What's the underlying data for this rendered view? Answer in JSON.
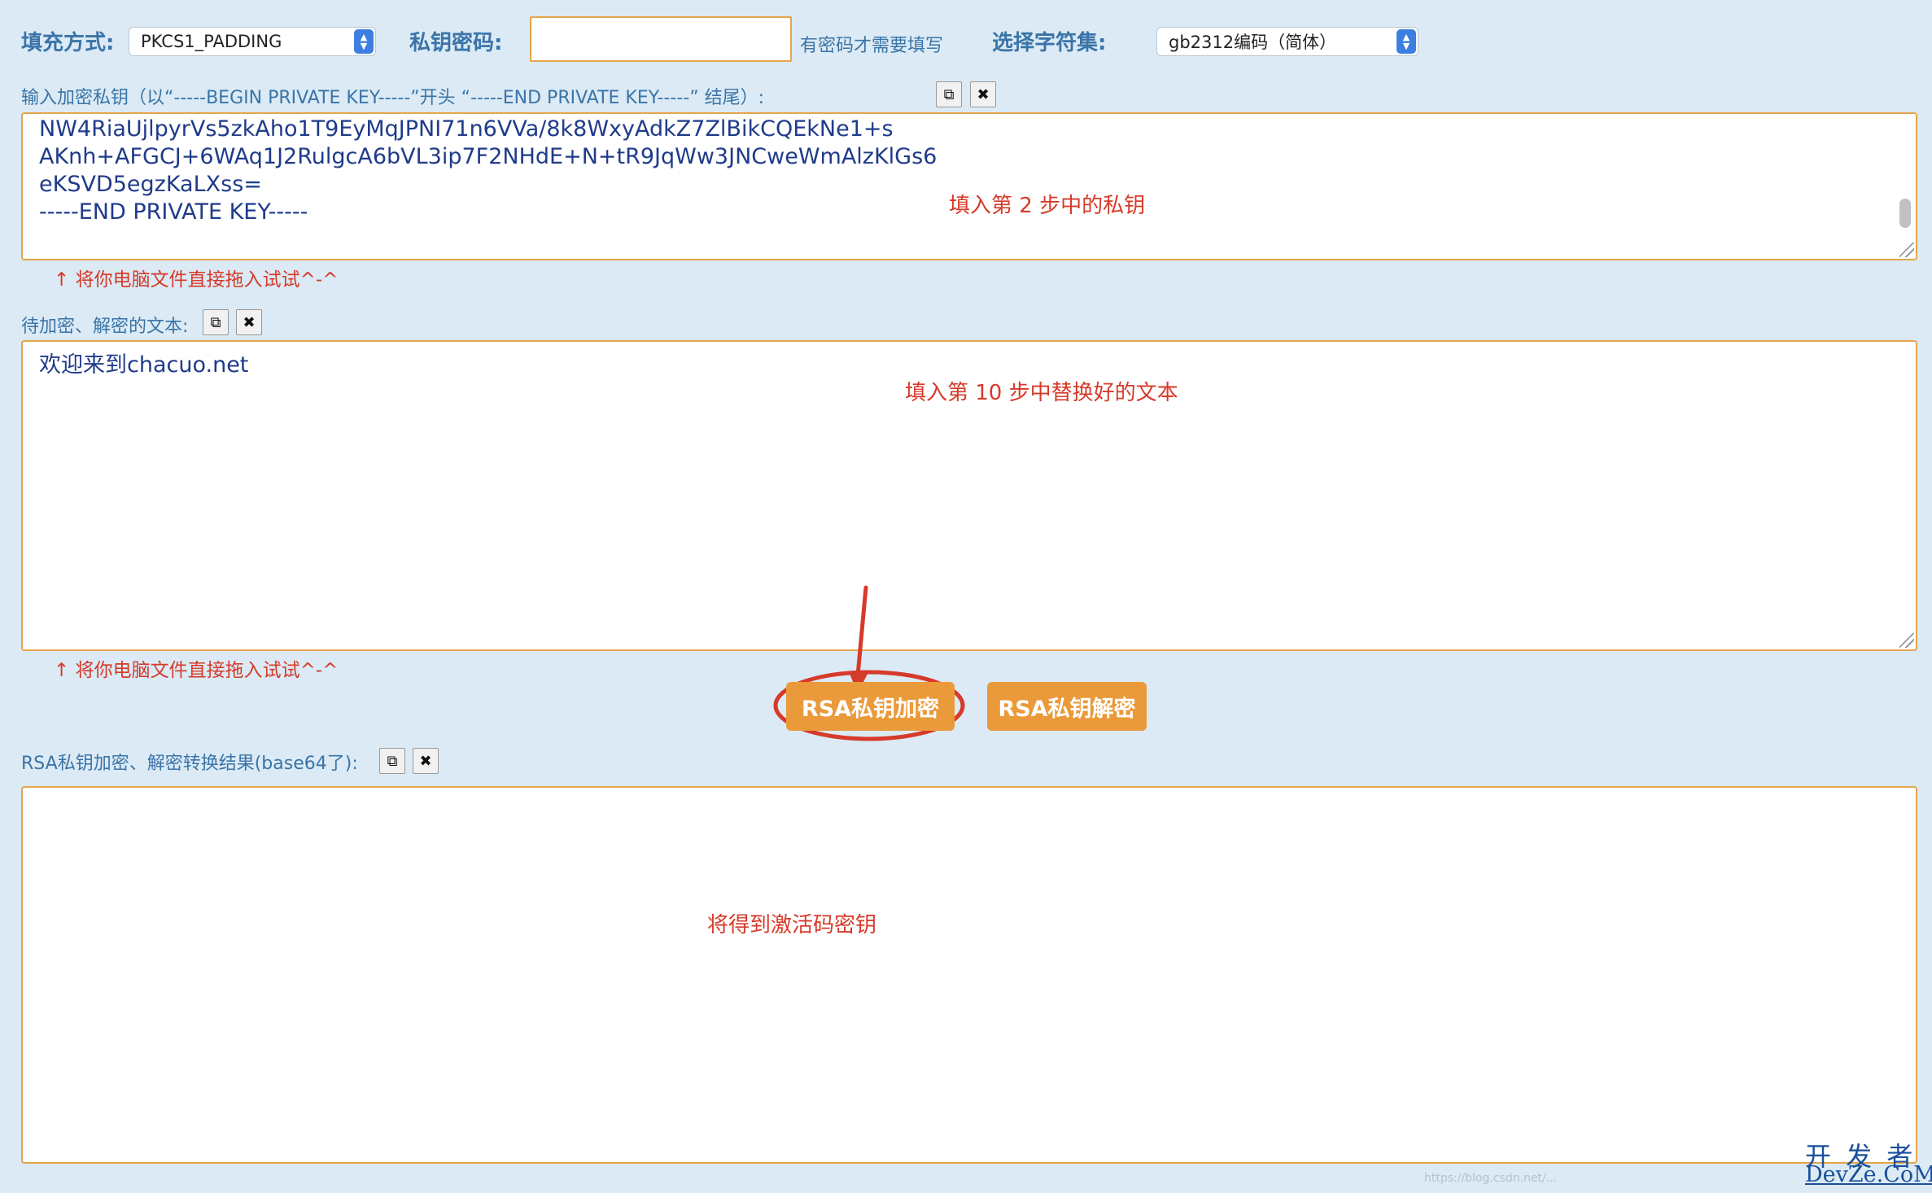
{
  "toolbar": {
    "padding_label": "填充方式:",
    "padding_value": "PKCS1_PADDING",
    "password_label": "私钥密码:",
    "password_value": "",
    "password_hint": "有密码才需要填写",
    "charset_label": "选择字符集:",
    "charset_value": "gb2312编码（简体）"
  },
  "private_key": {
    "label": "输入加密私钥（以“-----BEGIN PRIVATE KEY-----”开头 “-----END PRIVATE KEY-----” 结尾）:",
    "lines": [
      "NW4RiaUjlpyrVs5zkAho1T9EyMqJPNI71n6VVa/8k8WxyAdkZ7ZlBikCQEkNe1+s",
      "AKnh+AFGCJ+6WAq1J2RulgcA6bVL3ip7F2NHdE+N+tR9JqWw3JNCweWmAlzKlGs6",
      "eKSVD5egzKaLXss=",
      "-----END PRIVATE KEY-----"
    ],
    "annotation": "填入第 2 步中的私钥",
    "drag_hint": "↑ 将你电脑文件直接拖入试试^-^"
  },
  "plaintext": {
    "label": "待加密、解密的文本:",
    "value": "欢迎来到chacuo.net",
    "annotation": "填入第 10 步中替换好的文本",
    "drag_hint": "↑ 将你电脑文件直接拖入试试^-^"
  },
  "buttons": {
    "encrypt": "RSA私钥加密",
    "decrypt": "RSA私钥解密"
  },
  "result": {
    "label": "RSA私钥加密、解密转换结果(base64了):",
    "value": "",
    "annotation": "将得到激活码密钥"
  },
  "icons": {
    "copy": "copy-icon",
    "clear": "clear-icon"
  },
  "watermark": {
    "line1": "开 发 者",
    "line2": "DevZe.CoM",
    "faint": "https://blog.csdn.net/..."
  },
  "colors": {
    "background": "#dbeaf4",
    "label": "#3a74a8",
    "button": "#ea9a3a",
    "annotation": "#d63a2a",
    "textbox_border": "#e5a54b"
  }
}
